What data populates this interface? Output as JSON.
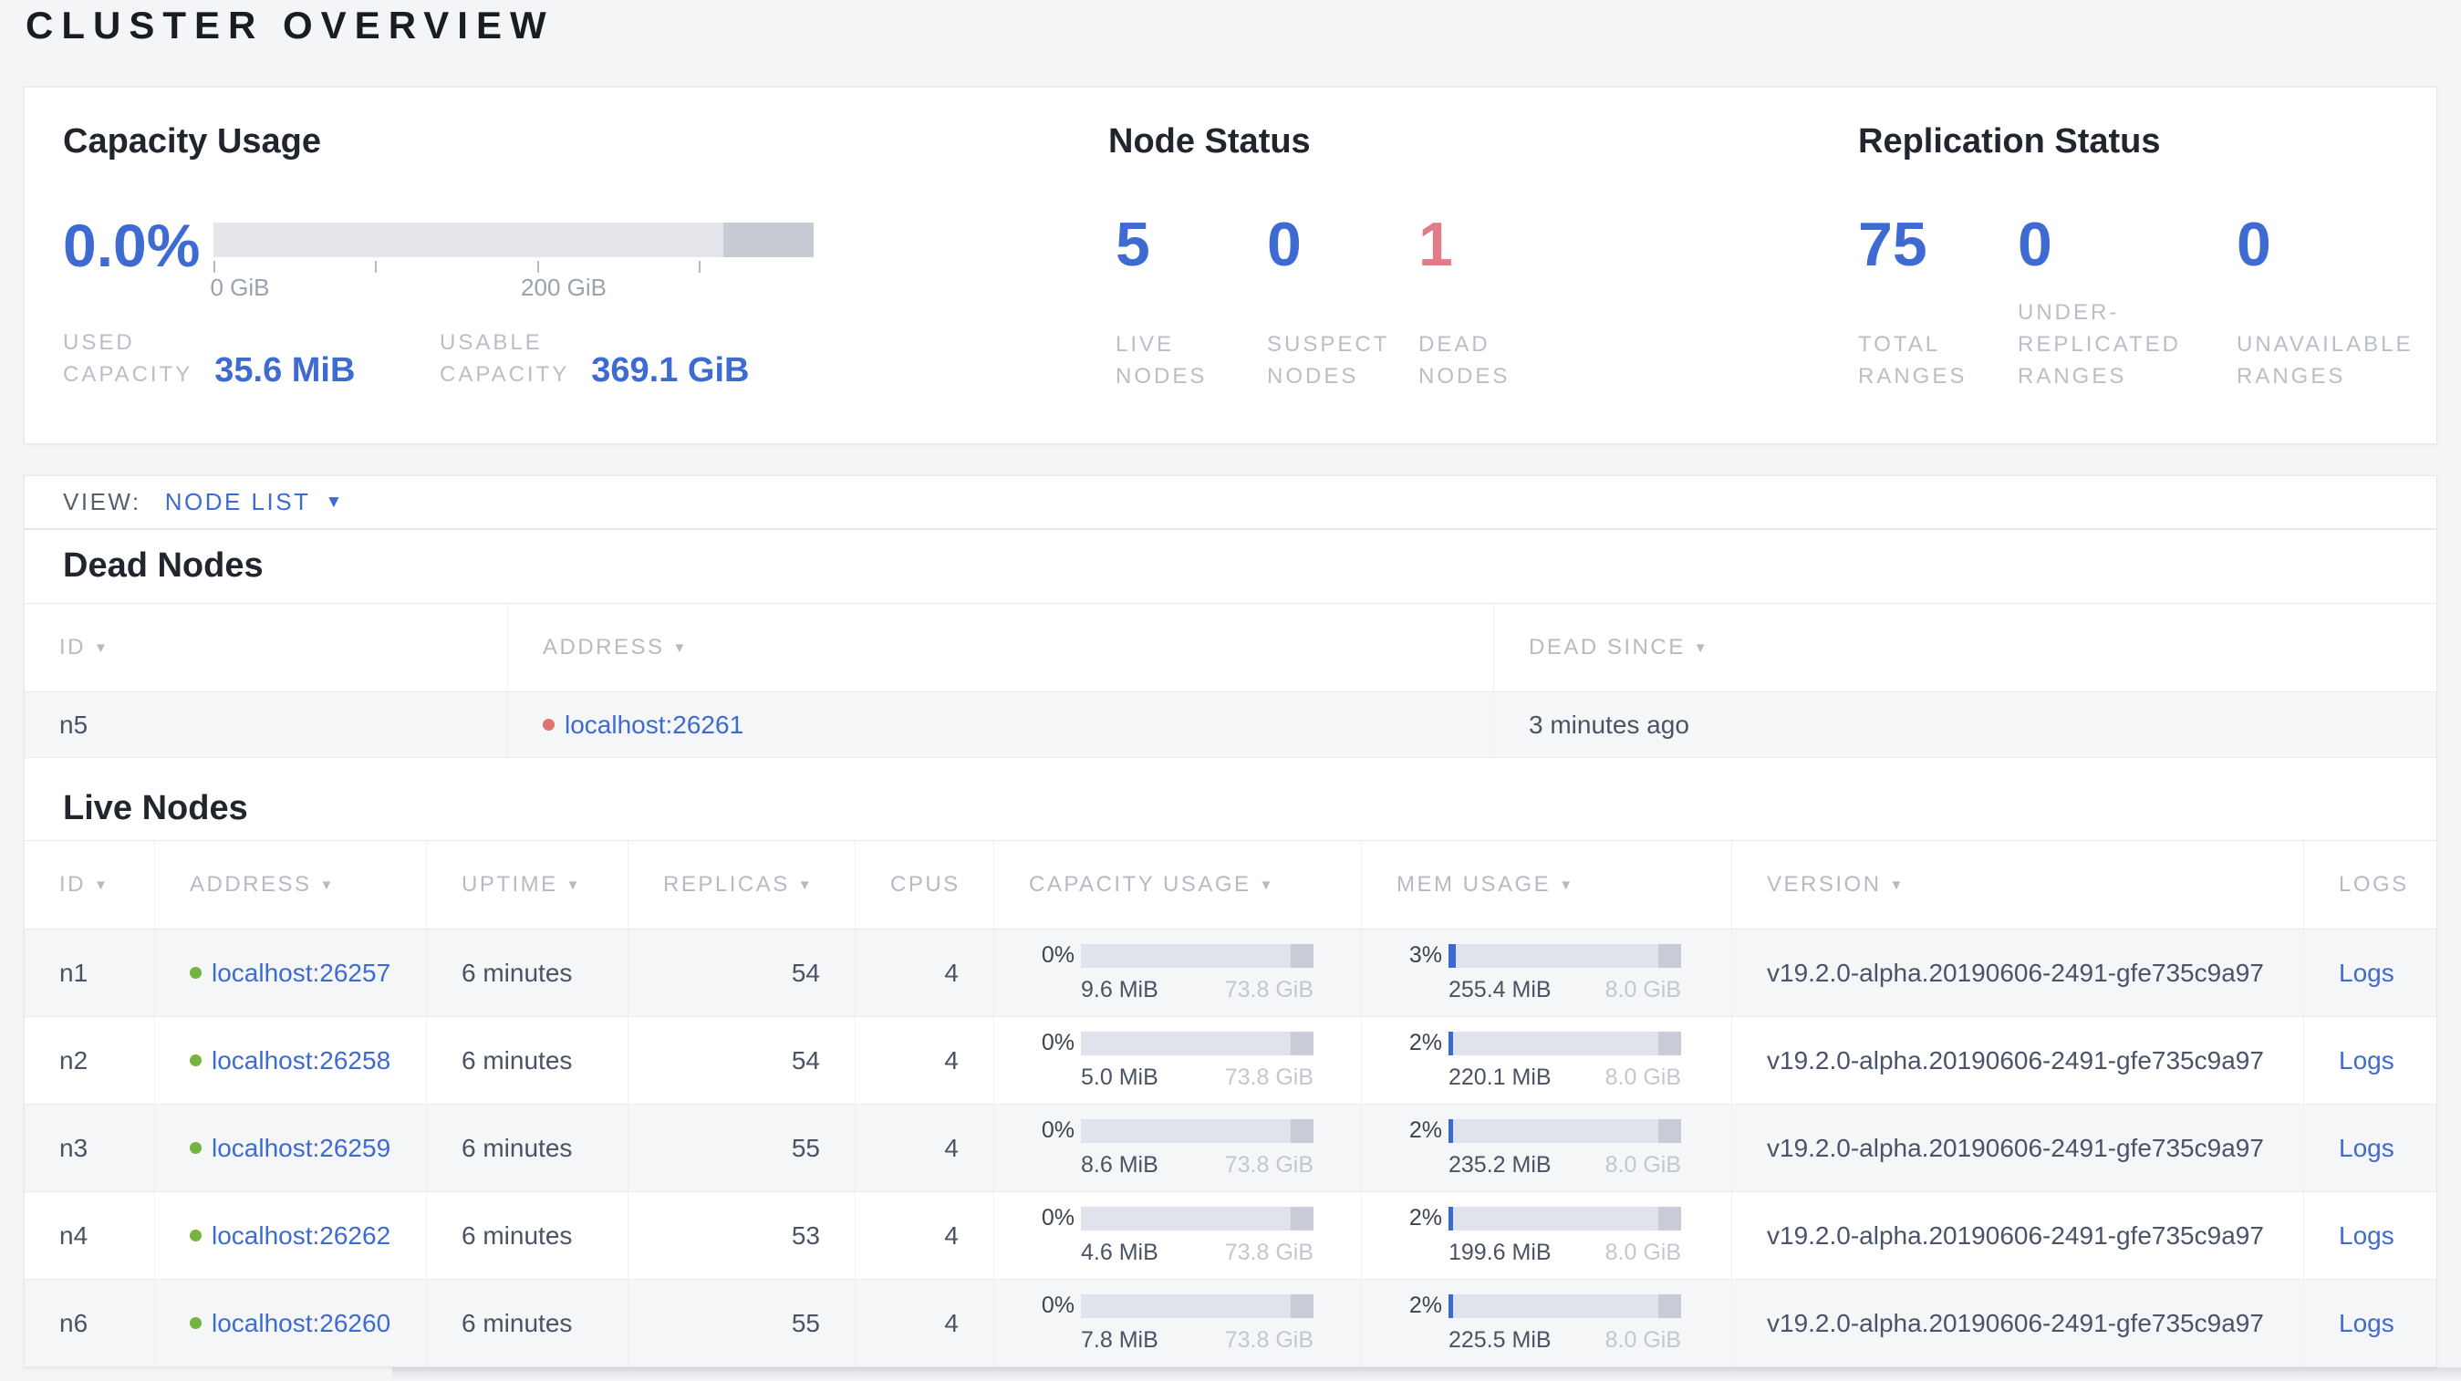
{
  "page": {
    "title": "CLUSTER OVERVIEW"
  },
  "icons": {
    "sort_desc": "▼",
    "dropdown_caret": "▼"
  },
  "colors": {
    "accent_blue": "#3e6bd2",
    "link_blue": "#3e6ad1",
    "danger_red": "#e17b87",
    "dead_dot_red": "#e0736d",
    "live_dot_green": "#77b33f"
  },
  "overview": {
    "capacity": {
      "heading": "Capacity Usage",
      "percent": "0.0%",
      "tick_labels": [
        "0 GiB",
        "200 GiB"
      ],
      "stats": [
        {
          "label": "USED\nCAPACITY",
          "value": "35.6 MiB"
        },
        {
          "label": "USABLE\nCAPACITY",
          "value": "369.1 GiB"
        }
      ]
    },
    "node_status": {
      "heading": "Node Status",
      "stats": [
        {
          "value": "5",
          "label": "LIVE\nNODES"
        },
        {
          "value": "0",
          "label": "SUSPECT\nNODES"
        },
        {
          "value": "1",
          "label": "DEAD\nNODES"
        }
      ]
    },
    "replication": {
      "heading": "Replication Status",
      "stats": [
        {
          "value": "75",
          "label": "TOTAL\nRANGES"
        },
        {
          "value": "0",
          "label": "UNDER-\nREPLICATED\nRANGES"
        },
        {
          "value": "0",
          "label": "UNAVAILABLE\nRANGES"
        }
      ]
    }
  },
  "view_bar": {
    "label": "VIEW:",
    "selected": "NODE LIST"
  },
  "dead_nodes": {
    "heading": "Dead Nodes",
    "columns": [
      {
        "label": "ID"
      },
      {
        "label": "ADDRESS"
      },
      {
        "label": "DEAD SINCE"
      }
    ],
    "rows": [
      {
        "id": "n5",
        "address": "localhost:26261",
        "dead_since": "3 minutes ago"
      }
    ]
  },
  "live_nodes": {
    "heading": "Live Nodes",
    "columns": [
      {
        "label": "ID"
      },
      {
        "label": "ADDRESS"
      },
      {
        "label": "UPTIME"
      },
      {
        "label": "REPLICAS"
      },
      {
        "label": "CPUS"
      },
      {
        "label": "CAPACITY USAGE"
      },
      {
        "label": "MEM USAGE"
      },
      {
        "label": "VERSION"
      },
      {
        "label": "LOGS"
      }
    ],
    "rows": [
      {
        "id": "n1",
        "address": "localhost:26257",
        "uptime": "6 minutes",
        "replicas": "54",
        "cpus": "4",
        "capacity": {
          "percent": "0%",
          "used": "9.6 MiB",
          "total": "73.8 GiB"
        },
        "mem": {
          "percent": "3%",
          "used": "255.4 MiB",
          "total": "8.0 GiB"
        },
        "version": "v19.2.0-alpha.20190606-2491-gfe735c9a97",
        "logs_label": "Logs"
      },
      {
        "id": "n2",
        "address": "localhost:26258",
        "uptime": "6 minutes",
        "replicas": "54",
        "cpus": "4",
        "capacity": {
          "percent": "0%",
          "used": "5.0 MiB",
          "total": "73.8 GiB"
        },
        "mem": {
          "percent": "2%",
          "used": "220.1 MiB",
          "total": "8.0 GiB"
        },
        "version": "v19.2.0-alpha.20190606-2491-gfe735c9a97",
        "logs_label": "Logs"
      },
      {
        "id": "n3",
        "address": "localhost:26259",
        "uptime": "6 minutes",
        "replicas": "55",
        "cpus": "4",
        "capacity": {
          "percent": "0%",
          "used": "8.6 MiB",
          "total": "73.8 GiB"
        },
        "mem": {
          "percent": "2%",
          "used": "235.2 MiB",
          "total": "8.0 GiB"
        },
        "version": "v19.2.0-alpha.20190606-2491-gfe735c9a97",
        "logs_label": "Logs"
      },
      {
        "id": "n4",
        "address": "localhost:26262",
        "uptime": "6 minutes",
        "replicas": "53",
        "cpus": "4",
        "capacity": {
          "percent": "0%",
          "used": "4.6 MiB",
          "total": "73.8 GiB"
        },
        "mem": {
          "percent": "2%",
          "used": "199.6 MiB",
          "total": "8.0 GiB"
        },
        "version": "v19.2.0-alpha.20190606-2491-gfe735c9a97",
        "logs_label": "Logs"
      },
      {
        "id": "n6",
        "address": "localhost:26260",
        "uptime": "6 minutes",
        "replicas": "55",
        "cpus": "4",
        "capacity": {
          "percent": "0%",
          "used": "7.8 MiB",
          "total": "73.8 GiB"
        },
        "mem": {
          "percent": "2%",
          "used": "225.5 MiB",
          "total": "8.0 GiB"
        },
        "version": "v19.2.0-alpha.20190606-2491-gfe735c9a97",
        "logs_label": "Logs"
      }
    ]
  }
}
